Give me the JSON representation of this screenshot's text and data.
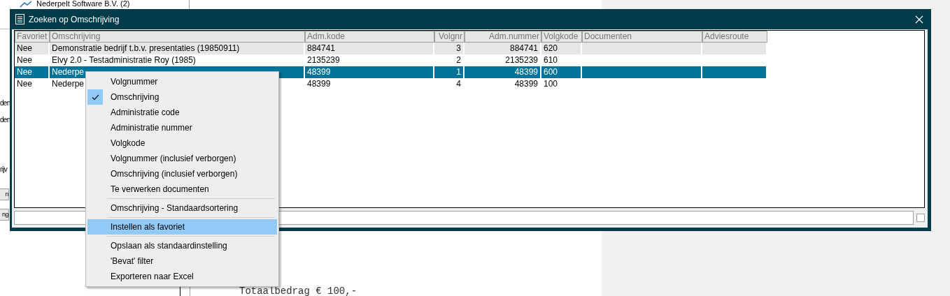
{
  "background": {
    "top_item": "Nederpelt Software B.V. (2)",
    "side_labels": [
      "den",
      "den",
      "rijv"
    ],
    "side_buttons": [
      "n",
      "ng"
    ],
    "body_text": "Totaalbedrag € 100,-"
  },
  "window": {
    "title": "Zoeken op Omschrijving"
  },
  "table": {
    "columns": [
      {
        "label": "Favoriet"
      },
      {
        "label": "Omschrijving"
      },
      {
        "label": "Adm.kode"
      },
      {
        "label": "Volgnr"
      },
      {
        "label": "Adm.nummer"
      },
      {
        "label": "Volgkode"
      },
      {
        "label": "Documenten"
      },
      {
        "label": "Adviesroute"
      }
    ],
    "rows": [
      {
        "cells": [
          "Nee",
          "Demonstratie bedrijf t.b.v. presentaties (19850911)",
          "884741",
          "3",
          "884741",
          "620",
          "",
          ""
        ],
        "shaded": true,
        "selected": false
      },
      {
        "cells": [
          "Nee",
          "Elvy 2.0 - Testadministratie Roy (1985)",
          "2135239",
          "2",
          "2135239",
          "610",
          "",
          ""
        ],
        "shaded": false,
        "selected": false
      },
      {
        "cells": [
          "Nee",
          "Nederpe",
          "48399",
          "1",
          "48399",
          "600",
          "",
          ""
        ],
        "shaded": false,
        "selected": true
      },
      {
        "cells": [
          "Nee",
          "Nederpe",
          "48399",
          "4",
          "48399",
          "100",
          "",
          ""
        ],
        "shaded": false,
        "selected": false
      }
    ]
  },
  "search": {
    "checked": false
  },
  "context_menu": {
    "items": [
      {
        "kind": "item",
        "label": "Volgnummer",
        "checked": false,
        "selected": false
      },
      {
        "kind": "item",
        "label": "Omschrijving",
        "checked": true,
        "selected": false
      },
      {
        "kind": "item",
        "label": "Administratie code",
        "checked": false,
        "selected": false
      },
      {
        "kind": "item",
        "label": "Administratie nummer",
        "checked": false,
        "selected": false
      },
      {
        "kind": "item",
        "label": "Volgkode",
        "checked": false,
        "selected": false
      },
      {
        "kind": "item",
        "label": "Volgnummer (inclusief verborgen)",
        "checked": false,
        "selected": false
      },
      {
        "kind": "item",
        "label": "Omschrijving (inclusief verborgen)",
        "checked": false,
        "selected": false
      },
      {
        "kind": "item",
        "label": "Te verwerken documenten",
        "checked": false,
        "selected": false
      },
      {
        "kind": "separator"
      },
      {
        "kind": "item",
        "label": "Omschrijving - Standaardsortering",
        "checked": false,
        "selected": false
      },
      {
        "kind": "separator"
      },
      {
        "kind": "item",
        "label": "Instellen als favoriet",
        "checked": false,
        "selected": true
      },
      {
        "kind": "separator"
      },
      {
        "kind": "item",
        "label": "Opslaan als standaardinstelling",
        "checked": false,
        "selected": false
      },
      {
        "kind": "item",
        "label": "'Bevat' filter",
        "checked": false,
        "selected": false
      },
      {
        "kind": "item",
        "label": "Exporteren naar Excel",
        "checked": false,
        "selected": false
      }
    ]
  }
}
